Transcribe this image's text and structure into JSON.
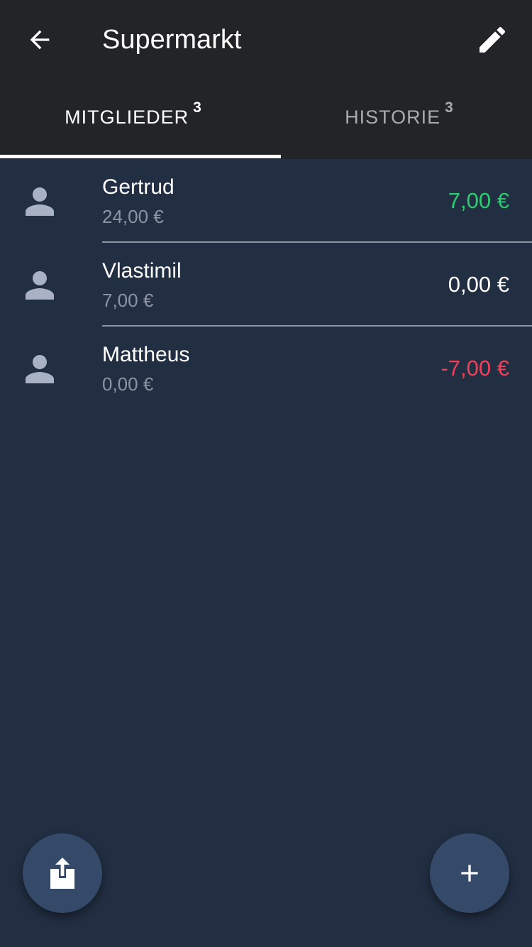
{
  "header": {
    "title": "Supermarkt",
    "back_icon": "arrow-left-icon",
    "edit_icon": "pencil-icon"
  },
  "tabs": [
    {
      "label": "MITGLIEDER",
      "count": "3",
      "active": true
    },
    {
      "label": "HISTORIE",
      "count": "3",
      "active": false
    }
  ],
  "members": [
    {
      "name": "Gertrud",
      "paid": "24,00 €",
      "balance": "7,00 €",
      "balance_color": "#2ecc71"
    },
    {
      "name": "Vlastimil",
      "paid": "7,00 €",
      "balance": "0,00 €",
      "balance_color": "#ffffff"
    },
    {
      "name": "Mattheus",
      "paid": "0,00 €",
      "balance": "-7,00 €",
      "balance_color": "#f0405a"
    }
  ],
  "actions": {
    "share_icon": "share-icon",
    "add_icon": "plus-icon"
  },
  "colors": {
    "appbar": "#232427",
    "background": "#222f43",
    "fab": "#344a68",
    "positive": "#2ecc71",
    "negative": "#f0405a"
  }
}
